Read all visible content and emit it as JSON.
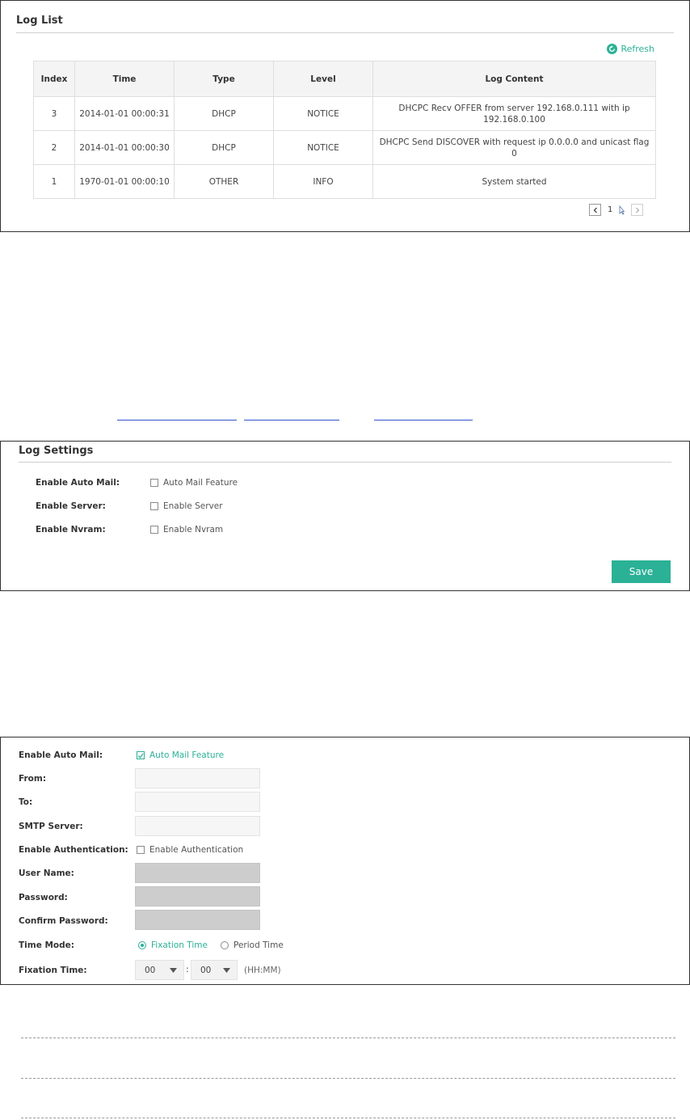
{
  "log_list": {
    "title": "Log List",
    "refresh_label": "Refresh",
    "columns": [
      "Index",
      "Time",
      "Type",
      "Level",
      "Log Content"
    ],
    "rows": [
      {
        "index": "3",
        "time": "2014-01-01 00:00:31",
        "type": "DHCP",
        "level": "NOTICE",
        "content": "DHCPC Recv OFFER from server 192.168.0.111 with ip 192.168.0.100"
      },
      {
        "index": "2",
        "time": "2014-01-01 00:00:30",
        "type": "DHCP",
        "level": "NOTICE",
        "content": "DHCPC Send DISCOVER with request ip 0.0.0.0 and unicast flag 0"
      },
      {
        "index": "1",
        "time": "1970-01-01 00:00:10",
        "type": "OTHER",
        "level": "INFO",
        "content": "System started"
      }
    ],
    "pagination": {
      "current_page": "1"
    }
  },
  "log_settings": {
    "title": "Log Settings",
    "fields": [
      {
        "label": "Enable Auto Mail:",
        "option": "Auto Mail Feature"
      },
      {
        "label": "Enable Server:",
        "option": "Enable Server"
      },
      {
        "label": "Enable Nvram:",
        "option": "Enable Nvram"
      }
    ],
    "save_label": "Save"
  },
  "mail_settings": {
    "enable_auto_mail": {
      "label": "Enable Auto Mail:",
      "option": "Auto Mail Feature",
      "checked": true
    },
    "from_label": "From:",
    "to_label": "To:",
    "smtp_label": "SMTP Server:",
    "enable_auth": {
      "label": "Enable Authentication:",
      "option": "Enable Authentication",
      "checked": false
    },
    "username_label": "User Name:",
    "password_label": "Password:",
    "confirm_password_label": "Confirm Password:",
    "time_mode": {
      "label": "Time Mode:",
      "options": [
        "Fixation Time",
        "Period Time"
      ],
      "selected": "Fixation Time"
    },
    "fixation_time": {
      "label": "Fixation Time:",
      "hour": "00",
      "minute": "00",
      "separator": ":",
      "format_hint": "(HH:MM)"
    }
  },
  "colors": {
    "accent": "#2bb196",
    "input_disabled": "#cdcdcd",
    "table_header_bg": "#f4f4f4"
  }
}
